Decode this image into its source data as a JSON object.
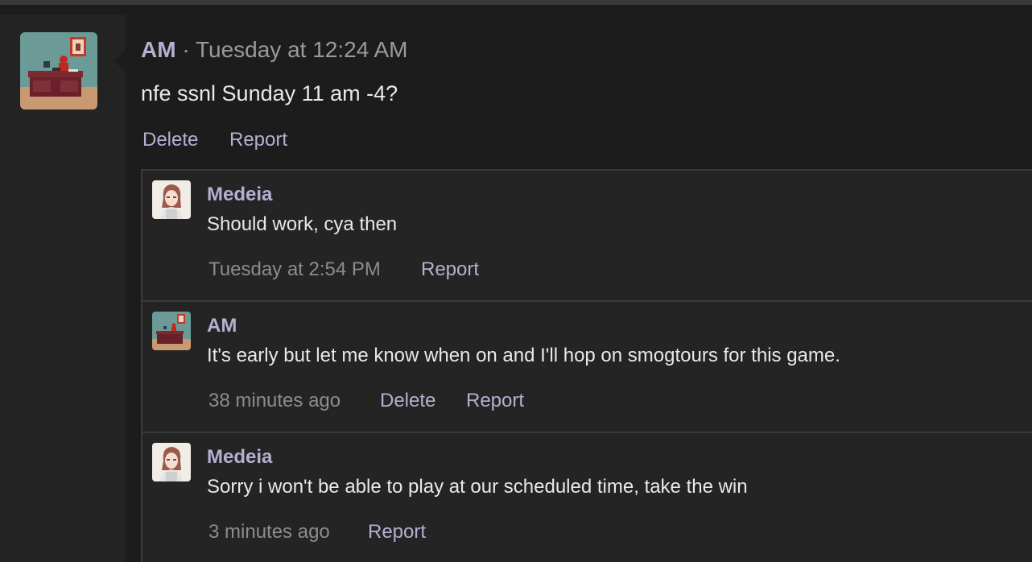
{
  "post": {
    "author": "AM",
    "separator": "·",
    "timestamp": "Tuesday at 12:24 AM",
    "text": "nfe ssnl Sunday 11 am -4?",
    "actions": {
      "delete": "Delete",
      "report": "Report"
    }
  },
  "comments": [
    {
      "author": "Medeia",
      "text": "Should work, cya then",
      "time": "Tuesday at 2:54 PM",
      "report": "Report"
    },
    {
      "author": "AM",
      "text": "It's early but let me know when on and I'll hop on smogtours for this game.",
      "time": "38 minutes ago",
      "delete": "Delete",
      "report": "Report"
    },
    {
      "author": "Medeia",
      "text": "Sorry i won't be able to play at our scheduled time, take the win",
      "time": "3 minutes ago",
      "report": "Report"
    }
  ],
  "colors": {
    "accent": "#b7aed1",
    "background": "#1c1c1c",
    "panel": "#242424",
    "text": "#eaeaea",
    "muted": "#9a9a9a"
  },
  "icons": {
    "am_avatar": "office-desk-avatar",
    "medeia_avatar": "anime-girl-avatar"
  }
}
